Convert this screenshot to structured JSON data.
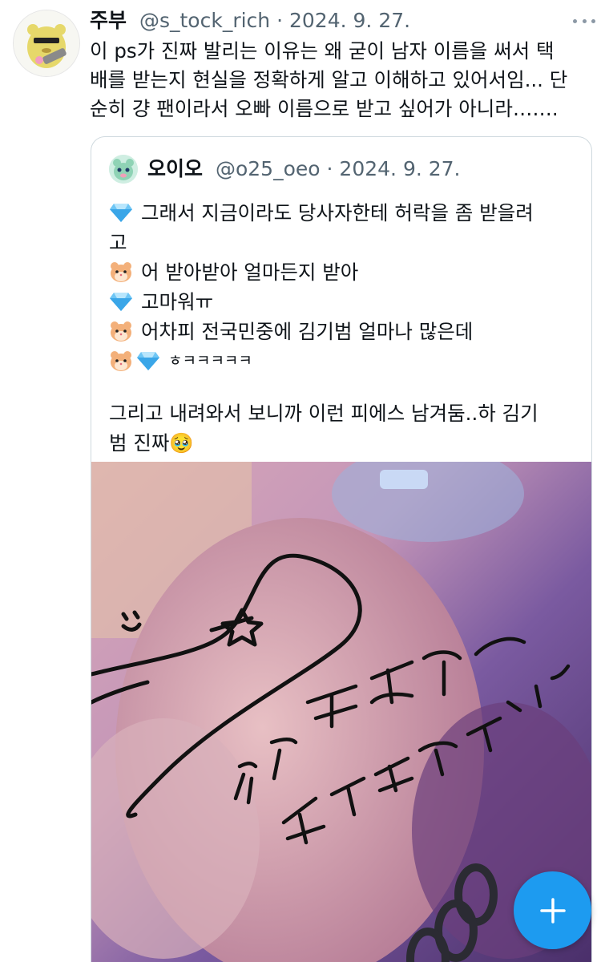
{
  "tweet": {
    "author_name": "주부",
    "handle": "@s_tock_rich",
    "separator": "·",
    "date": "2024. 9. 27.",
    "text": "이 ps가 진짜 발리는 이유는 왜 굳이 남자 이름을 써서 택\n배를 받는지 현실을 정확하게 알고 이해하고 있어서임... 단\n순히 걍 팬이라서 오빠 이름으로 받고 싶어가 아니라……."
  },
  "quote": {
    "author_name": "오이오",
    "handle": "@o25_oeo",
    "separator": "·",
    "date": "2024. 9. 27.",
    "lines": [
      {
        "icons": [
          "gem-icon"
        ],
        "text": "그래서 지금이라도 당사자한테 허락을 좀 받을려"
      },
      {
        "icons": [],
        "text": "고"
      },
      {
        "icons": [
          "hamster-icon"
        ],
        "text": "어 받아받아 얼마든지 받아"
      },
      {
        "icons": [
          "gem-icon"
        ],
        "text": "고마워ㅠ"
      },
      {
        "icons": [
          "hamster-icon"
        ],
        "text": "어차피 전국민중에 김기범 얼마나 많은데"
      },
      {
        "icons": [
          "hamster-icon",
          "gem-icon"
        ],
        "text": "ㅎㅋㅋㅋㅋㅋ"
      }
    ],
    "paragraph": "그리고 내려와서 보니까 이런 피에스 남겨둠..하 김기\n범 진짜🥹",
    "photo": {
      "handwritten_text": "그렇게 이름으로 날 지켜줄수있다면!♥"
    }
  },
  "fab": {
    "icon": "plus-icon"
  },
  "colors": {
    "text": "#0f1419",
    "secondary": "#536471",
    "border": "#cfd9de",
    "accent": "#1d9bf0"
  }
}
